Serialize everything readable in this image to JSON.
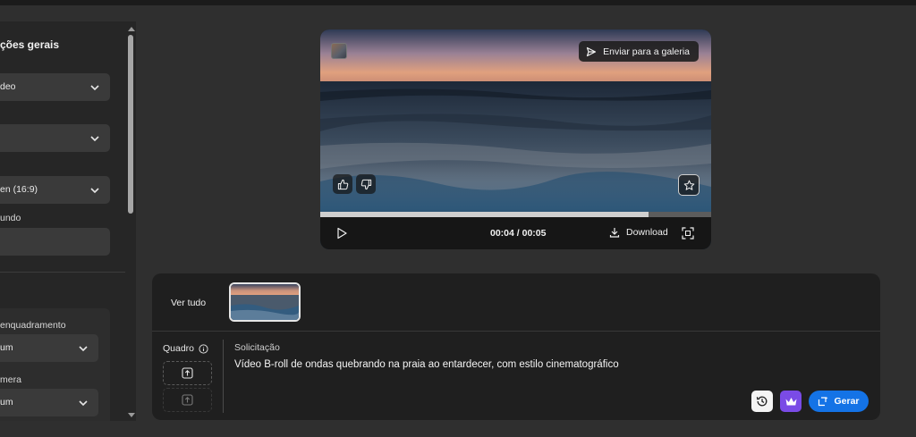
{
  "sidebar": {
    "section_title": "ções gerais",
    "select_1": "deo",
    "select_2": "",
    "select_3": "en (16:9)",
    "label_background": "undo",
    "input_background": "",
    "group": {
      "label_framing": "enquadramento",
      "select_framing": "um",
      "label_camera": "mera",
      "select_camera": "um"
    }
  },
  "player": {
    "send_to_gallery": "Enviar para a galeria",
    "time": "00:04 / 00:05",
    "progress": 0.84,
    "download_label": "Download",
    "icons": [
      "thumbs-up-icon",
      "thumbs-down-icon",
      "star-icon",
      "play-icon",
      "download-icon",
      "fullscreen-icon",
      "send-icon"
    ]
  },
  "panel": {
    "see_all": "Ver tudo",
    "frame_label": "Quadro",
    "prompt_label": "Solicitação",
    "prompt_text": "Vídeo B-roll de ondas quebrando na praia ao entardecer, com estilo cinematográfico",
    "generate_label": "Gerar",
    "colors": {
      "generate": "#1473e6",
      "premium": "#7a4be6"
    }
  }
}
